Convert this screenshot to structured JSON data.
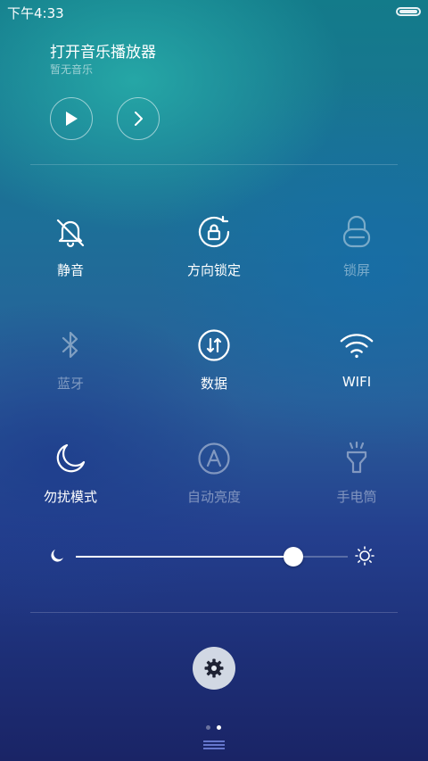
{
  "status_bar": {
    "time": "下午4:33",
    "battery_icon": "battery-icon"
  },
  "music": {
    "title": "打开音乐播放器",
    "subtitle": "暂无音乐",
    "play_icon": "play-icon",
    "next_icon": "chevron-right-icon"
  },
  "toggles": [
    {
      "label": "静音",
      "icon": "bell-off-icon",
      "state": "on"
    },
    {
      "label": "方向锁定",
      "icon": "rotation-lock-icon",
      "state": "on"
    },
    {
      "label": "锁屏",
      "icon": "lock-icon",
      "state": "off"
    },
    {
      "label": "蓝牙",
      "icon": "bluetooth-icon",
      "state": "off"
    },
    {
      "label": "数据",
      "icon": "data-arrows-icon",
      "state": "on"
    },
    {
      "label": "WIFI",
      "icon": "wifi-icon",
      "state": "on"
    },
    {
      "label": "勿扰模式",
      "icon": "moon-icon",
      "state": "on"
    },
    {
      "label": "自动亮度",
      "icon": "auto-brightness-icon",
      "state": "off"
    },
    {
      "label": "手电筒",
      "icon": "flashlight-icon",
      "state": "off"
    }
  ],
  "brightness": {
    "level": 0.8,
    "min_icon": "moon-icon",
    "max_icon": "sun-icon"
  },
  "settings": {
    "icon": "gear-icon"
  },
  "pager": {
    "pages": 2,
    "current": 2
  },
  "colors": {
    "active": "#ffffff",
    "inactive": "rgba(255,255,255,0.42)",
    "slider_track": "rgba(255,255,255,0.25)"
  }
}
